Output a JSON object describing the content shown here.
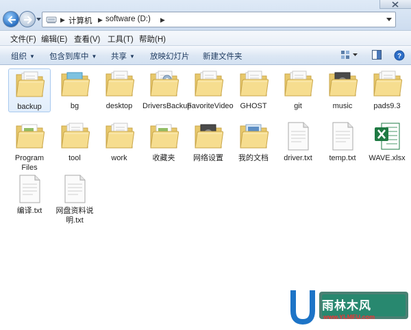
{
  "address_bar": {
    "crumbs": [
      "计算机",
      "software (D:)"
    ]
  },
  "menu": {
    "items": [
      "文件(F)",
      "编辑(E)",
      "查看(V)",
      "工具(T)",
      "帮助(H)"
    ]
  },
  "command_bar": {
    "items": [
      "组织",
      "包含到库中",
      "共享",
      "放映幻灯片",
      "新建文件夹"
    ]
  },
  "files": [
    {
      "label": "backup",
      "type": "folder-docs",
      "selected": true
    },
    {
      "label": "bg",
      "type": "folder-blue"
    },
    {
      "label": "desktop",
      "type": "folder-docs"
    },
    {
      "label": "DriversBackup",
      "type": "folder-gear"
    },
    {
      "label": "FavoriteVideo",
      "type": "folder-docs"
    },
    {
      "label": "GHOST",
      "type": "folder-docs"
    },
    {
      "label": "git",
      "type": "folder-docs"
    },
    {
      "label": "music",
      "type": "folder-dark"
    },
    {
      "label": "pads9.3",
      "type": "folder-docs"
    },
    {
      "label": "Program Files",
      "type": "folder-green"
    },
    {
      "label": "tool",
      "type": "folder-docs"
    },
    {
      "label": "work",
      "type": "folder-docs"
    },
    {
      "label": "收藏夹",
      "type": "folder-green"
    },
    {
      "label": "网络设置",
      "type": "folder-dark"
    },
    {
      "label": "我的文档",
      "type": "folder-blue-doc"
    },
    {
      "label": "driver.txt",
      "type": "txt"
    },
    {
      "label": "temp.txt",
      "type": "txt"
    },
    {
      "label": "WAVE.xlsx",
      "type": "xlsx"
    },
    {
      "label": "编译.txt",
      "type": "txt"
    },
    {
      "label": "网盘资料说明.txt",
      "type": "txt"
    }
  ],
  "watermark": {
    "text": "雨林木风",
    "url": "www.YLMFU.com"
  }
}
